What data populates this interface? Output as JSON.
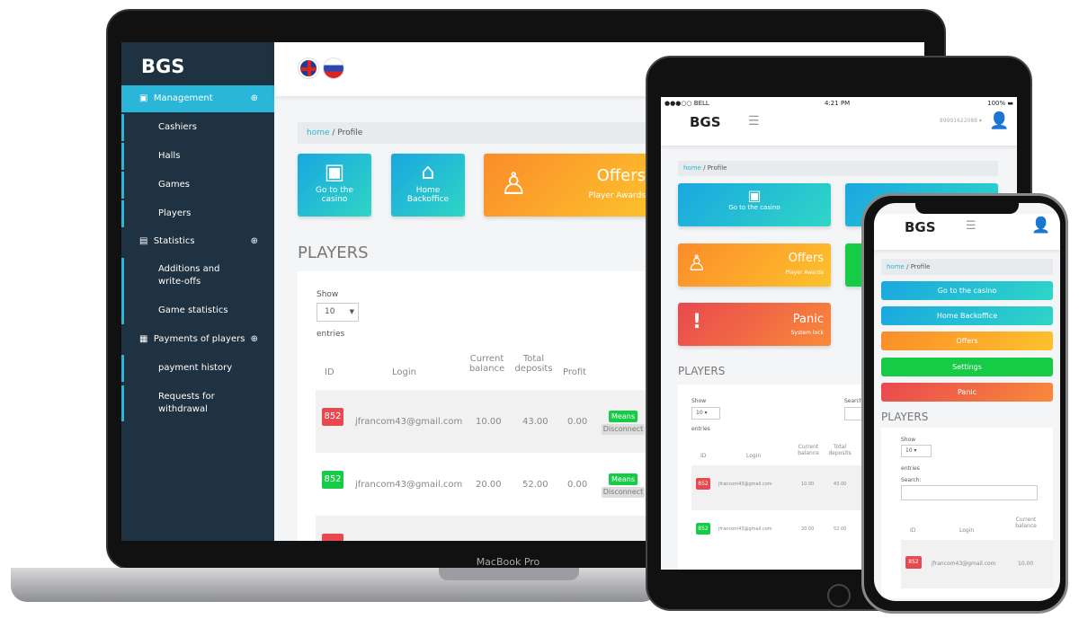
{
  "laptop": {
    "label": "MacBook Pro",
    "logo": "BGS",
    "flags": [
      "uk-flag",
      "russia-flag"
    ],
    "sidebar": [
      {
        "label": "Management",
        "type": "section",
        "active": true
      },
      {
        "label": "Cashiers"
      },
      {
        "label": "Halls"
      },
      {
        "label": "Games"
      },
      {
        "label": "Players"
      },
      {
        "label": "Statistics",
        "type": "section"
      },
      {
        "label": "Additions and write-offs"
      },
      {
        "label": "Game statistics"
      },
      {
        "label": "Payments of players",
        "type": "section"
      },
      {
        "label": "payment history"
      },
      {
        "label": "Requests for withdrawal"
      }
    ],
    "breadcrumb": {
      "home": "home",
      "sep": "/",
      "current": "Profile"
    },
    "tiles": [
      {
        "label": "Go to the casino"
      },
      {
        "label": "Home Backoffice"
      },
      {
        "title": "Offers",
        "sub": "Player Awards"
      }
    ],
    "section_title": "PLAYERS",
    "show": "Show",
    "entries_value": "10",
    "entries": "entries",
    "headers": [
      "ID",
      "Login",
      "Current balance",
      "Total deposits",
      "Profit"
    ],
    "rows": [
      {
        "id": "852",
        "login": "jfrancom43@gmail.com",
        "balance": "10.00",
        "deposits": "43.00",
        "profit": "0.00",
        "status": "red"
      },
      {
        "id": "852",
        "login": "jfrancom43@gmail.com",
        "balance": "20.00",
        "deposits": "52.00",
        "profit": "0.00",
        "status": "green"
      }
    ],
    "means": "Means",
    "disconnect": "Disconnect"
  },
  "tablet": {
    "status": {
      "carrier": "BELL",
      "time": "4:21 PM",
      "battery": "100%"
    },
    "logo": "BGS",
    "user": "89991622088",
    "breadcrumb": {
      "home": "home",
      "sep": "/",
      "current": "Profile"
    },
    "tiles": [
      {
        "label": "Go to the casino"
      },
      {
        "title": "Offers",
        "sub": "Player Awards"
      },
      {
        "title": "Panic",
        "sub": "System lock"
      }
    ],
    "section_title": "PLAYERS",
    "show": "Show",
    "entries_value": "10",
    "entries": "entries",
    "search": "Search",
    "headers": [
      "ID",
      "Login",
      "Current balance",
      "Total deposits"
    ],
    "rows": [
      {
        "id": "852",
        "login": "jfrancom43@gmail.com",
        "balance": "10.00",
        "deposits": "43.00"
      },
      {
        "id": "852",
        "login": "jfrancom43@gmail.com",
        "balance": "20.00",
        "deposits": "52.00"
      }
    ]
  },
  "phone": {
    "logo": "BGS",
    "breadcrumb": {
      "home": "home",
      "sep": "/",
      "current": "Profile"
    },
    "buttons": [
      "Go to the casino",
      "Home Backoffice",
      "Offers",
      "Settings",
      "Panic"
    ],
    "section_title": "PLAYERS",
    "show": "Show",
    "entries_value": "10",
    "entries": "entries",
    "search": "Search:",
    "headers": [
      "ID",
      "Login",
      "Current balance"
    ],
    "row": {
      "id": "852",
      "login": "jfrancom43@gmail.com",
      "balance": "10.00"
    }
  },
  "colors": {
    "sidebar": "#1f3241",
    "accent": "#29b6d8",
    "green": "#16cc46",
    "red": "#e8484f",
    "orange": "#fb8c2a"
  }
}
